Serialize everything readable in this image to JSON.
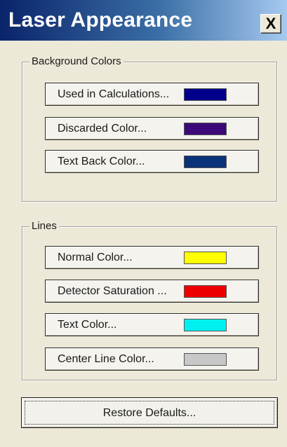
{
  "window": {
    "title": "Laser Appearance",
    "close_label": "X"
  },
  "background_colors": {
    "group_label": "Background Colors",
    "buttons": [
      {
        "label": "Used in Calculations...",
        "color": "#00008b"
      },
      {
        "label": "Discarded Color...",
        "color": "#3c0a78"
      },
      {
        "label": "Text Back Color...",
        "color": "#0a3278"
      }
    ]
  },
  "lines": {
    "group_label": "Lines",
    "buttons": [
      {
        "label": "Normal Color...",
        "color": "#ffff00"
      },
      {
        "label": "Detector Saturation ...",
        "color": "#ee0000"
      },
      {
        "label": "Text Color...",
        "color": "#00f0f0"
      },
      {
        "label": "Center Line Color...",
        "color": "#c8c8c8"
      }
    ]
  },
  "restore_label": "Restore Defaults..."
}
